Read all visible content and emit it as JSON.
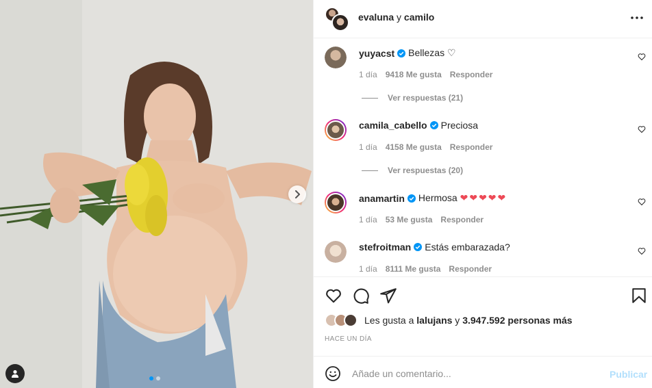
{
  "post": {
    "author_label": "evaluna",
    "author_joiner": " y ",
    "coauthor_label": "camilo",
    "media": {
      "current_index": 1,
      "total_slides": 2
    }
  },
  "comments": [
    {
      "username": "yuyacst",
      "verified": true,
      "text": "Bellezas ♡",
      "time": "1 día",
      "likes": "9418 Me gusta",
      "reply": "Responder",
      "replies": "Ver respuestas (21)",
      "avatar_color": "#8a7a6a"
    },
    {
      "username": "camila_cabello",
      "verified": true,
      "text": "Preciosa",
      "time": "1 día",
      "likes": "4158 Me gusta",
      "reply": "Responder",
      "replies": "Ver respuestas (20)",
      "avatar_color": "#c8a88a"
    },
    {
      "username": "anamartin",
      "verified": true,
      "text": "Hermosa ❤❤❤❤❤",
      "time": "1 día",
      "likes": "53 Me gusta",
      "reply": "Responder",
      "avatar_color": "#b58c6e"
    },
    {
      "username": "stefroitman",
      "verified": true,
      "text": "Estás embarazada?",
      "time": "1 día",
      "likes": "8111 Me gusta",
      "reply": "Responder",
      "avatar_color": "#e2d0c0"
    }
  ],
  "likes_summary": {
    "prefix": "Les gusta a ",
    "user": "lalujans",
    "middle": " y ",
    "count": "3.947.592 personas más"
  },
  "time_ago": "HACE UN DÍA",
  "add_comment": {
    "placeholder": "Añade un comentario...",
    "post_label": "Publicar"
  },
  "colors": {
    "verified": "#0095f6",
    "post_button_disabled": "#b2dffc",
    "heart_red": "#ed4956"
  },
  "icons": [
    "more-icon",
    "heart-icon",
    "comment-icon",
    "share-icon",
    "save-icon",
    "emoji-icon",
    "chevron-right-icon",
    "user-tag-icon",
    "verified-badge-icon"
  ]
}
